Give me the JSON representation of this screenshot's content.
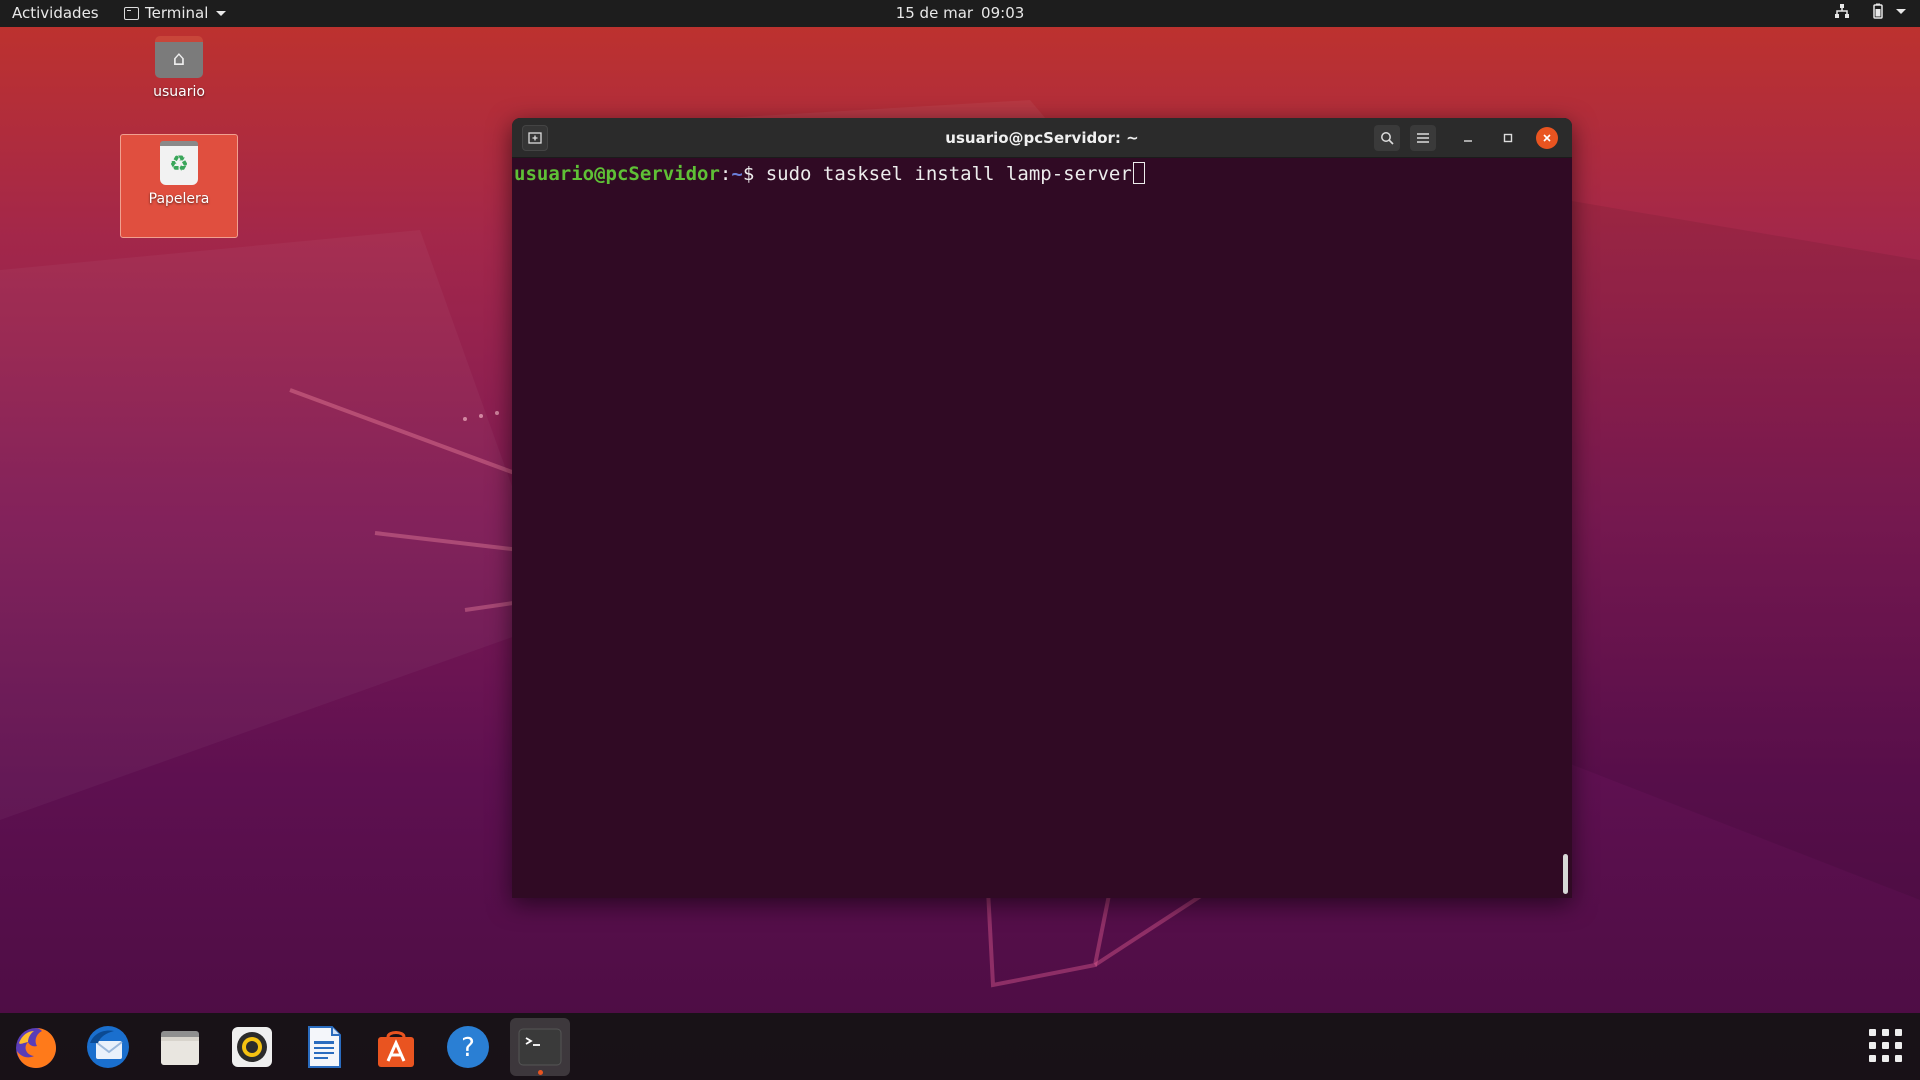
{
  "topbar": {
    "activities": "Actividades",
    "app_menu": "Terminal",
    "date": "15 de mar",
    "time": "09:03"
  },
  "desktop": {
    "icons": [
      {
        "label": "usuario",
        "icon": "home-folder-icon"
      },
      {
        "label": "Papelera",
        "icon": "trash-icon"
      }
    ]
  },
  "terminal": {
    "title": "usuario@pcServidor: ~",
    "prompt_user_host": "usuario@pcServidor",
    "prompt_sep": ":",
    "prompt_path": "~",
    "prompt_symbol": "$",
    "command": "sudo tasksel install lamp-server",
    "colors": {
      "background": "#300a24",
      "prompt": "#5fc036",
      "path": "#6a7fd8",
      "close": "#e95420"
    }
  },
  "dock": {
    "apps": [
      "firefox-icon",
      "thunderbird-icon",
      "files-icon",
      "rhythmbox-icon",
      "libreoffice-writer-icon",
      "ubuntu-software-icon",
      "help-icon",
      "terminal-icon"
    ],
    "active": "terminal-icon"
  }
}
